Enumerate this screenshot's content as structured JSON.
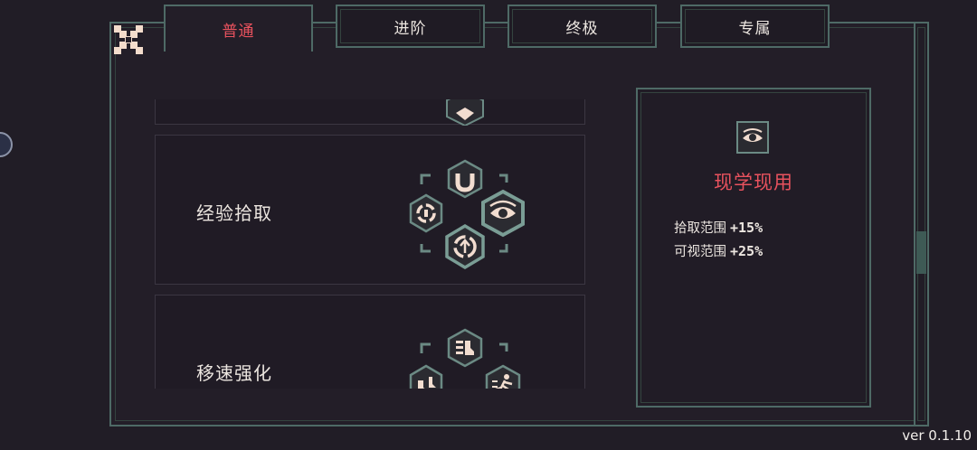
{
  "tabs": [
    {
      "label": "普通",
      "active": true
    },
    {
      "label": "进阶",
      "active": false
    },
    {
      "label": "终极",
      "active": false
    },
    {
      "label": "专属",
      "active": false
    }
  ],
  "close_icon": "close-x-icon",
  "skills": [
    {
      "title": "",
      "icons": [
        "shield-icon"
      ]
    },
    {
      "title": "经验拾取",
      "icons": [
        "magnet-icon",
        "orbit-icon",
        "eye-icon",
        "arrow-up-cycle-icon"
      ]
    },
    {
      "title": "移速强化",
      "icons": [
        "boots-icon",
        "running-boots-icon",
        "runner-icon"
      ]
    }
  ],
  "detail": {
    "icon": "eye-icon",
    "title": "现学现用",
    "stats": [
      {
        "label": "拾取范围",
        "value": "+15%"
      },
      {
        "label": "可视范围",
        "value": "+25%"
      }
    ]
  },
  "scroll_position": 0.58,
  "version": "ver 0.1.10",
  "colors": {
    "accent_red": "#e9525e",
    "frame_teal": "#4e6a66",
    "background": "#211d26",
    "icon_cream": "#f2ddd0"
  }
}
